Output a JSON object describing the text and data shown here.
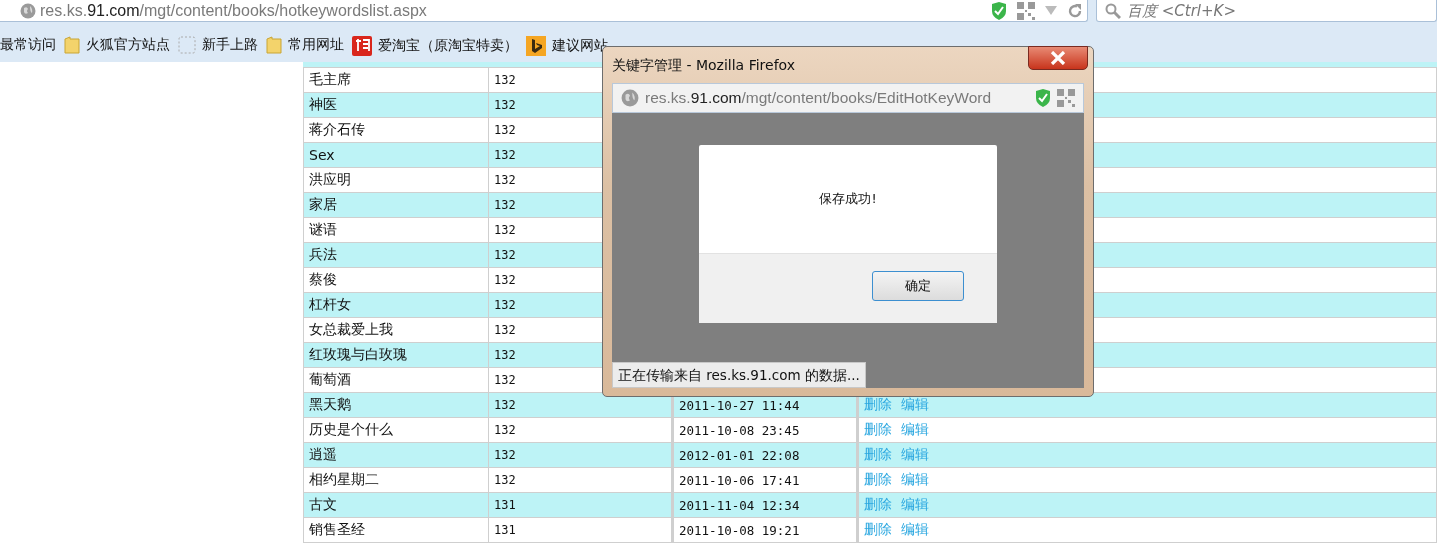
{
  "browser": {
    "address": {
      "host_prefix": "res.ks.",
      "host_domain": "91.com",
      "path": "/mgt/content/books/hotkeywordslist.aspx"
    },
    "search": {
      "placeholder": "百度 <Ctrl+K>"
    },
    "bookmarks": [
      {
        "label": "最常访问",
        "kind": "plain"
      },
      {
        "label": "火狐官方站点",
        "kind": "folder"
      },
      {
        "label": "新手上路",
        "kind": "dashed"
      },
      {
        "label": "常用网址",
        "kind": "folder"
      },
      {
        "label": "爱淘宝（原淘宝特卖）",
        "kind": "taobao"
      },
      {
        "label": "建议网站",
        "kind": "bing"
      }
    ]
  },
  "table": {
    "rows": [
      {
        "keyword": "毛主席",
        "count": "132"
      },
      {
        "keyword": "神医",
        "count": "132"
      },
      {
        "keyword": "蒋介石传",
        "count": "132"
      },
      {
        "keyword": "Sex",
        "count": "132"
      },
      {
        "keyword": "洪应明",
        "count": "132"
      },
      {
        "keyword": "家居",
        "count": "132"
      },
      {
        "keyword": "谜语",
        "count": "132"
      },
      {
        "keyword": "兵法",
        "count": "132"
      },
      {
        "keyword": "蔡俊",
        "count": "132"
      },
      {
        "keyword": "杠杆女",
        "count": "132"
      },
      {
        "keyword": "女总裁爱上我",
        "count": "132"
      },
      {
        "keyword": "红玫瑰与白玫瑰",
        "count": "132"
      },
      {
        "keyword": "葡萄酒",
        "count": "132"
      },
      {
        "keyword": "黑天鹅",
        "count": "132",
        "date": "2011-10-27 11:44",
        "actions": [
          "删除",
          "编辑"
        ]
      },
      {
        "keyword": "历史是个什么",
        "count": "132",
        "date": "2011-10-08 23:45",
        "actions": [
          "删除",
          "编辑"
        ]
      },
      {
        "keyword": "逍遥",
        "count": "132",
        "date": "2012-01-01 22:08",
        "actions": [
          "删除",
          "编辑"
        ]
      },
      {
        "keyword": "相约星期二",
        "count": "132",
        "date": "2011-10-06 17:41",
        "actions": [
          "删除",
          "编辑"
        ]
      },
      {
        "keyword": "古文",
        "count": "131",
        "date": "2011-11-04 12:34",
        "actions": [
          "删除",
          "编辑"
        ]
      },
      {
        "keyword": "销售圣经",
        "count": "131",
        "date": "2011-10-08 19:21",
        "actions": [
          "删除",
          "编辑"
        ]
      }
    ]
  },
  "popup": {
    "title": "关键字管理 - Mozilla Firefox",
    "address": {
      "host_prefix": "res.ks.",
      "host_domain": "91.com",
      "path": "/mgt/content/books/EditHotKeyWord"
    },
    "dialog": {
      "message": "保存成功!",
      "button": "确定"
    },
    "status": "正在传输来自 res.ks.91.com 的数据..."
  }
}
